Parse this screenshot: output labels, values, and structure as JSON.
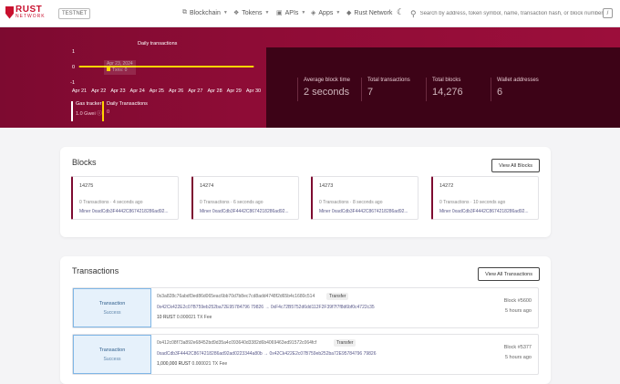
{
  "header": {
    "logo_line1": "RUST",
    "logo_line2": "NETWORK",
    "env_badge": "TESTNET",
    "nav": [
      {
        "icon": "blockchain-icon",
        "label": "Blockchain"
      },
      {
        "icon": "tokens-icon",
        "label": "Tokens"
      },
      {
        "icon": "apis-icon",
        "label": "APIs"
      },
      {
        "icon": "apps-icon",
        "label": "Apps"
      },
      {
        "icon": "network-icon",
        "label": "Rust Network"
      }
    ],
    "theme_icon": "moon-icon",
    "search_placeholder": "Search by address, token symbol, name, transaction hash, or block number",
    "search_shortcut": "/"
  },
  "hero": {
    "chart_title": "Daily transactions",
    "tooltip_date": "Apr 23, 2024",
    "tooltip_series": "Txns: 0",
    "gas_tracker_label": "Gas tracker",
    "gas_tracker_value": "1.0 Gwei",
    "daily_tx_label": "Daily Transactions",
    "daily_tx_value": "0",
    "stats": [
      {
        "label": "Average block time",
        "value": "2 seconds"
      },
      {
        "label": "Total transactions",
        "value": "7"
      },
      {
        "label": "Total blocks",
        "value": "14,276"
      },
      {
        "label": "Wallet addresses",
        "value": "6"
      }
    ],
    "accent_color": "#ffd400"
  },
  "chart_data": {
    "type": "line",
    "title": "Daily transactions",
    "categories": [
      "Apr 21",
      "Apr 22",
      "Apr 23",
      "Apr 24",
      "Apr 25",
      "Apr 26",
      "Apr 27",
      "Apr 28",
      "Apr 29",
      "Apr 30"
    ],
    "series": [
      {
        "values": [
          0,
          0,
          0,
          0,
          0,
          0,
          0,
          0,
          0,
          0
        ]
      }
    ],
    "yticks": [
      "1",
      "0",
      "-1"
    ],
    "ylim": [
      -1,
      1
    ],
    "line_color": "#ffd400"
  },
  "blocks": {
    "title": "Blocks",
    "view_all": "View All Blocks",
    "items": [
      {
        "number": "14275",
        "meta": "0 Transactions  ·  4 seconds ago",
        "miner": "Miner 0xadCdb3F4442C8674218286ad92..."
      },
      {
        "number": "14274",
        "meta": "0 Transactions  ·  6 seconds ago",
        "miner": "Miner 0xadCdb3F4442C8674218286ad92..."
      },
      {
        "number": "14273",
        "meta": "0 Transactions  ·  8 seconds ago",
        "miner": "Miner 0xadCdb3F4442C8674218286ad92..."
      },
      {
        "number": "14272",
        "meta": "0 Transactions  ·  10 seconds ago",
        "miner": "Miner 0xadCdb3F4442C8674218286ad92..."
      }
    ]
  },
  "transactions": {
    "title": "Transactions",
    "view_all": "View All Transactions",
    "items": [
      {
        "status_title": "Transaction",
        "status": "Success",
        "hash": "0x3a828c76abdf3ed86d065eac6bb70d7b8ec7cd8add4748f2d65b4c1680c514",
        "type": "Transfer",
        "from_to": "0x42Ck422E2c07B759eb252ba72E95784796 79826  →  0xF4c72B5752d6dd112F2F39f7f7f8d6bf0c4722c35",
        "amount": "10 RUST",
        "fee": "0.000021 TX Fee",
        "block": "Block #5600",
        "age": "5 hours ago"
      },
      {
        "status_title": "Transaction",
        "status": "Success",
        "hash": "0x412c08f73a892e68452bd9d35a4c093640d3382d6b4069463ed91572c064fcf",
        "type": "Transfer",
        "from_to": "0xadCdb3F4442C8674218286ad92ad0223344a80b  →  0x42Ck422E2c07B759eb252ba72E95784796 79826",
        "amount": "1,000,000 RUST",
        "fee": "0.000021 TX Fee",
        "block": "Block #5377",
        "age": "5 hours ago"
      }
    ]
  }
}
